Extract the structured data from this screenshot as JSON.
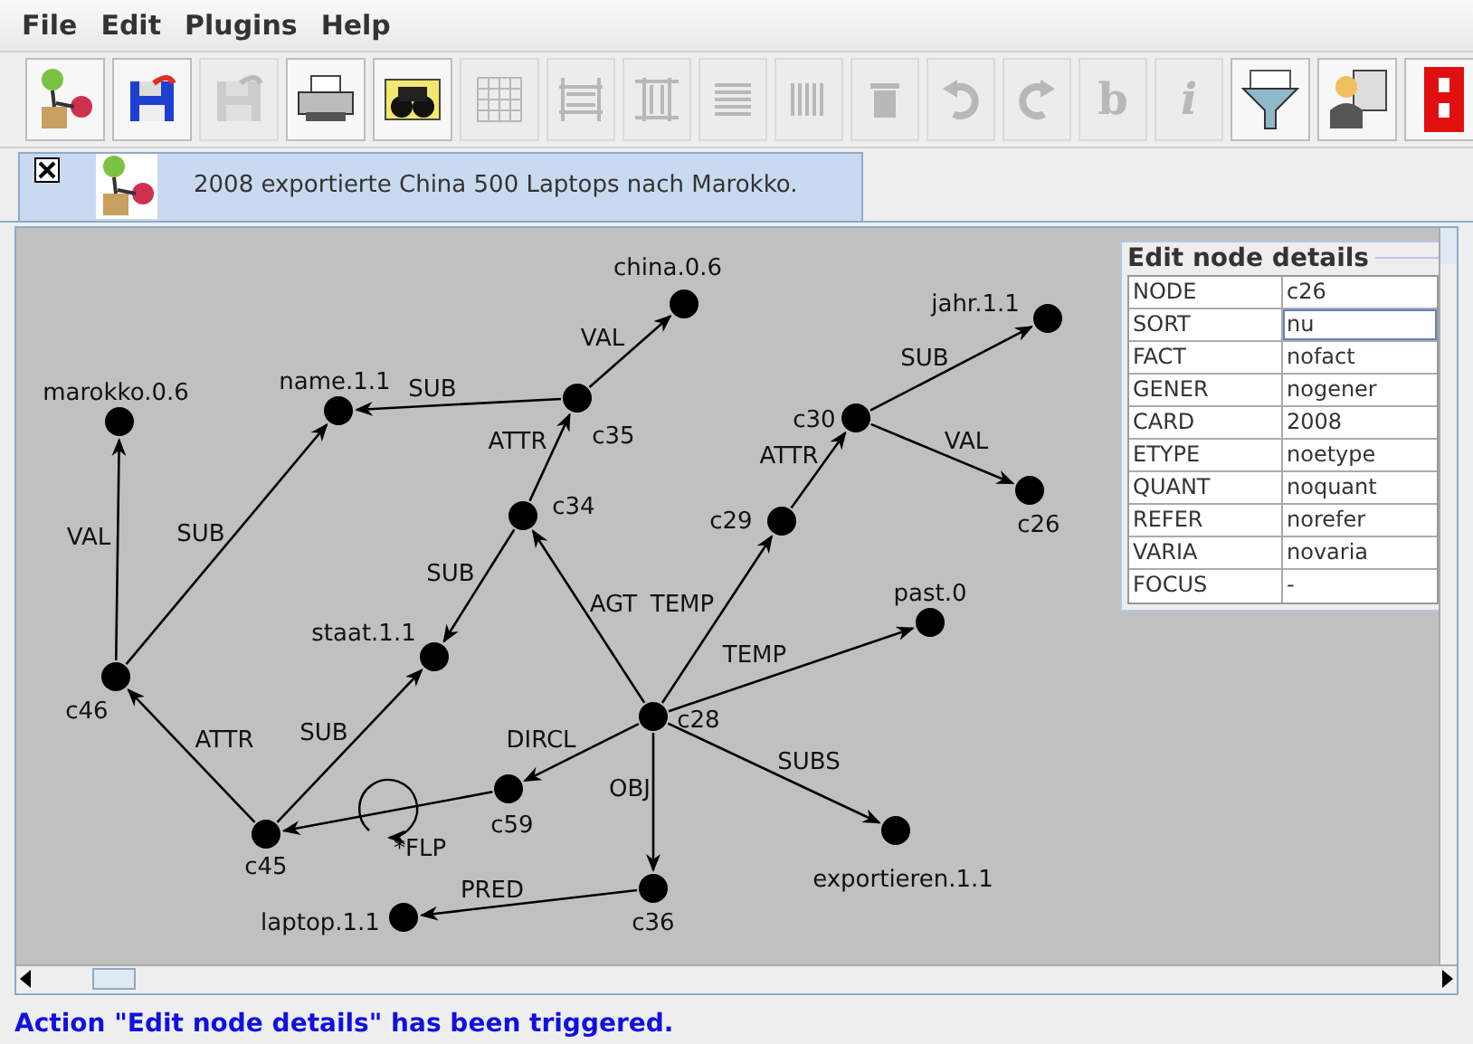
{
  "menu": [
    {
      "label": "File"
    },
    {
      "label": "Edit"
    },
    {
      "label": "Plugins"
    },
    {
      "label": "Help"
    }
  ],
  "toolbar": [
    {
      "kind": "app",
      "disabled": false
    },
    {
      "kind": "save",
      "disabled": false
    },
    {
      "kind": "save",
      "disabled": true
    },
    {
      "kind": "print",
      "disabled": false
    },
    {
      "kind": "find",
      "disabled": false
    },
    {
      "kind": "grid",
      "disabled": true
    },
    {
      "kind": "rows",
      "disabled": true
    },
    {
      "kind": "cols",
      "disabled": true
    },
    {
      "kind": "lines",
      "disabled": true
    },
    {
      "kind": "bars",
      "disabled": true
    },
    {
      "kind": "trash",
      "disabled": true
    },
    {
      "kind": "undo",
      "disabled": true
    },
    {
      "kind": "redo",
      "disabled": true
    },
    {
      "kind": "text",
      "label": "b",
      "disabled": true
    },
    {
      "kind": "text",
      "label": "i",
      "disabled": true
    },
    {
      "kind": "funnel",
      "disabled": false
    },
    {
      "kind": "teacher",
      "disabled": false
    },
    {
      "kind": "red",
      "disabled": false
    }
  ],
  "tab": {
    "title": "2008 exportierte China 500 Laptops nach Marokko.",
    "selected": true
  },
  "nodes": [
    {
      "label": "marokko.0.6"
    },
    {
      "label": "name.1.1"
    },
    {
      "label": "china.0.6"
    },
    {
      "label": "c35"
    },
    {
      "label": "jahr.1.1"
    },
    {
      "label": "c30"
    },
    {
      "label": "c26"
    },
    {
      "label": "c34"
    },
    {
      "label": "c29"
    },
    {
      "label": "past.0"
    },
    {
      "label": "staat.1.1"
    },
    {
      "label": "c46"
    },
    {
      "label": "c28"
    },
    {
      "label": "c59"
    },
    {
      "label": "c45"
    },
    {
      "label": "exportieren.1.1"
    },
    {
      "label": "c36"
    },
    {
      "label": "laptop.1.1"
    }
  ],
  "edges": [
    {
      "label": "VAL"
    },
    {
      "label": "SUB"
    },
    {
      "label": "ATTR"
    },
    {
      "label": "SUB"
    },
    {
      "label": "VAL"
    },
    {
      "label": "SUB"
    },
    {
      "label": "ATTR"
    },
    {
      "label": "SUB"
    },
    {
      "label": "AGT"
    },
    {
      "label": "TEMP"
    },
    {
      "label": "ATTR"
    },
    {
      "label": "SUB"
    },
    {
      "label": "VAL"
    },
    {
      "label": "TEMP"
    },
    {
      "label": "DIRCL"
    },
    {
      "label": "SUBS"
    },
    {
      "label": "OBJ"
    },
    {
      "label": "PRED"
    }
  ],
  "loop": {
    "label": "*FLP"
  },
  "details": {
    "title": "Edit node details",
    "rows": [
      {
        "key": "NODE",
        "value": "c26",
        "selected": false
      },
      {
        "key": "SORT",
        "value": "nu",
        "selected": true
      },
      {
        "key": "FACT",
        "value": "nofact",
        "selected": false
      },
      {
        "key": "GENER",
        "value": "nogener",
        "selected": false
      },
      {
        "key": "CARD",
        "value": "2008",
        "selected": false
      },
      {
        "key": "ETYPE",
        "value": "noetype",
        "selected": false
      },
      {
        "key": "QUANT",
        "value": "noquant",
        "selected": false
      },
      {
        "key": "REFER",
        "value": "norefer",
        "selected": false
      },
      {
        "key": "VARIA",
        "value": "novaria",
        "selected": false
      },
      {
        "key": "FOCUS",
        "value": "-",
        "selected": false
      }
    ]
  },
  "status": "Action \"Edit node details\" has been triggered."
}
